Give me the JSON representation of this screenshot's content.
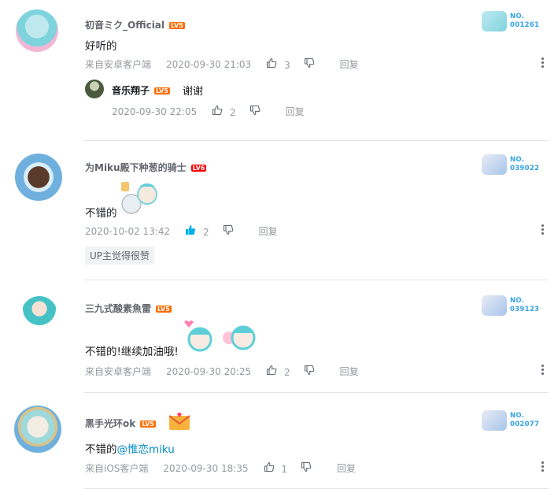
{
  "comments": [
    {
      "username": "初音ミク_Official",
      "level": "LV5",
      "text": "好听的",
      "source": "来自安卓客户端",
      "time": "2020-09-30 21:03",
      "likes": "3",
      "reply_label": "回复",
      "badge": "NO.\n001261",
      "badge_line1": "NO.",
      "badge_line2": "001261",
      "reply": {
        "username": "音乐翔子",
        "level": "LV5",
        "text": "谢谢",
        "time": "2020-09-30 22:05",
        "likes": "2",
        "reply_label": "回复"
      }
    },
    {
      "username": "为Miku殿下种葱的骑士",
      "level": "LV6",
      "text": "不错的",
      "time": "2020-10-02 13:42",
      "likes": "2",
      "liked": true,
      "reply_label": "回复",
      "badge_line1": "NO.",
      "badge_line2": "039022",
      "tag": "UP主觉得很赞"
    },
    {
      "username": "三九式酸素魚雷",
      "level": "LV5",
      "text": "不错的!继续加油哦!",
      "source": "来自安卓客户端",
      "time": "2020-09-30 20:25",
      "likes": "2",
      "reply_label": "回复",
      "badge_line1": "NO.",
      "badge_line2": "039123"
    },
    {
      "username": "黑手光环ok",
      "level": "LV5",
      "text_prefix": "不错的",
      "mention": "@惟恋miku",
      "source": "来自iOS客户端",
      "time": "2020-09-30 18:35",
      "likes": "1",
      "reply_label": "回复",
      "badge_line1": "NO.",
      "badge_line2": "002077"
    }
  ],
  "colors": {
    "level5": "#ff6c00",
    "level6": "#ff0000",
    "like_active": "#00aeec",
    "link": "#008ac5",
    "badge_text": "#33a2e4"
  }
}
